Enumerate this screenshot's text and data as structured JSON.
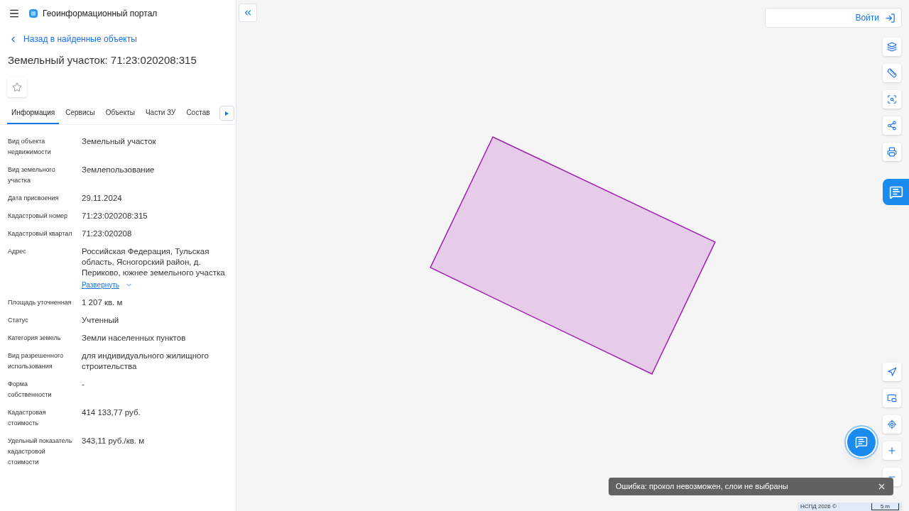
{
  "header": {
    "title": "Геоинформационный портал"
  },
  "back_link": "Назад в найденные объекты",
  "object_title": "Земельный участок: 71:23:020208:315",
  "favorite": {
    "selected": false
  },
  "tabs": [
    {
      "label": "Информация",
      "selected": true
    },
    {
      "label": "Сервисы",
      "selected": false
    },
    {
      "label": "Объекты",
      "selected": false
    },
    {
      "label": "Части ЗУ",
      "selected": false
    },
    {
      "label": "Состав",
      "selected": false
    }
  ],
  "properties": [
    {
      "label": "Вид объекта недвижимости",
      "value": "Земельный участок"
    },
    {
      "label": "Вид земельного участка",
      "value": "Землепользование"
    },
    {
      "label": "Дата присвоения",
      "value": "29.11.2024"
    },
    {
      "label": "Кадастровый номер",
      "value": "71:23:020208:315"
    },
    {
      "label": "Кадастровый квартал",
      "value": "71:23:020208"
    },
    {
      "label": "Адрес",
      "value": "Российская Федерация, Тульская область, Ясногорский район, д. Периково, южнее земельного участка",
      "expand_link": "Развернуть"
    },
    {
      "label": "Площадь уточненная",
      "value": "1 207 кв. м"
    },
    {
      "label": "Статус",
      "value": "Учтенный"
    },
    {
      "label": "Категория земель",
      "value": "Земли населенных пунктов"
    },
    {
      "label": "Вид разрешенного использования",
      "value": "для индивидуального жилищного строительства"
    },
    {
      "label": "Форма собственности",
      "value": "-"
    },
    {
      "label": "Кадастровая стоимость",
      "value": "414 133,77 руб."
    },
    {
      "label": "Удельный показатель кадастровой стоимости",
      "value": "343,11 руб./кв. м"
    }
  ],
  "login_button": "Войти",
  "toast": {
    "message": "Ошибка: прокол невозможен, слои не выбраны"
  },
  "attribution": "НСПД 2026 ©",
  "scale": "5 m"
}
